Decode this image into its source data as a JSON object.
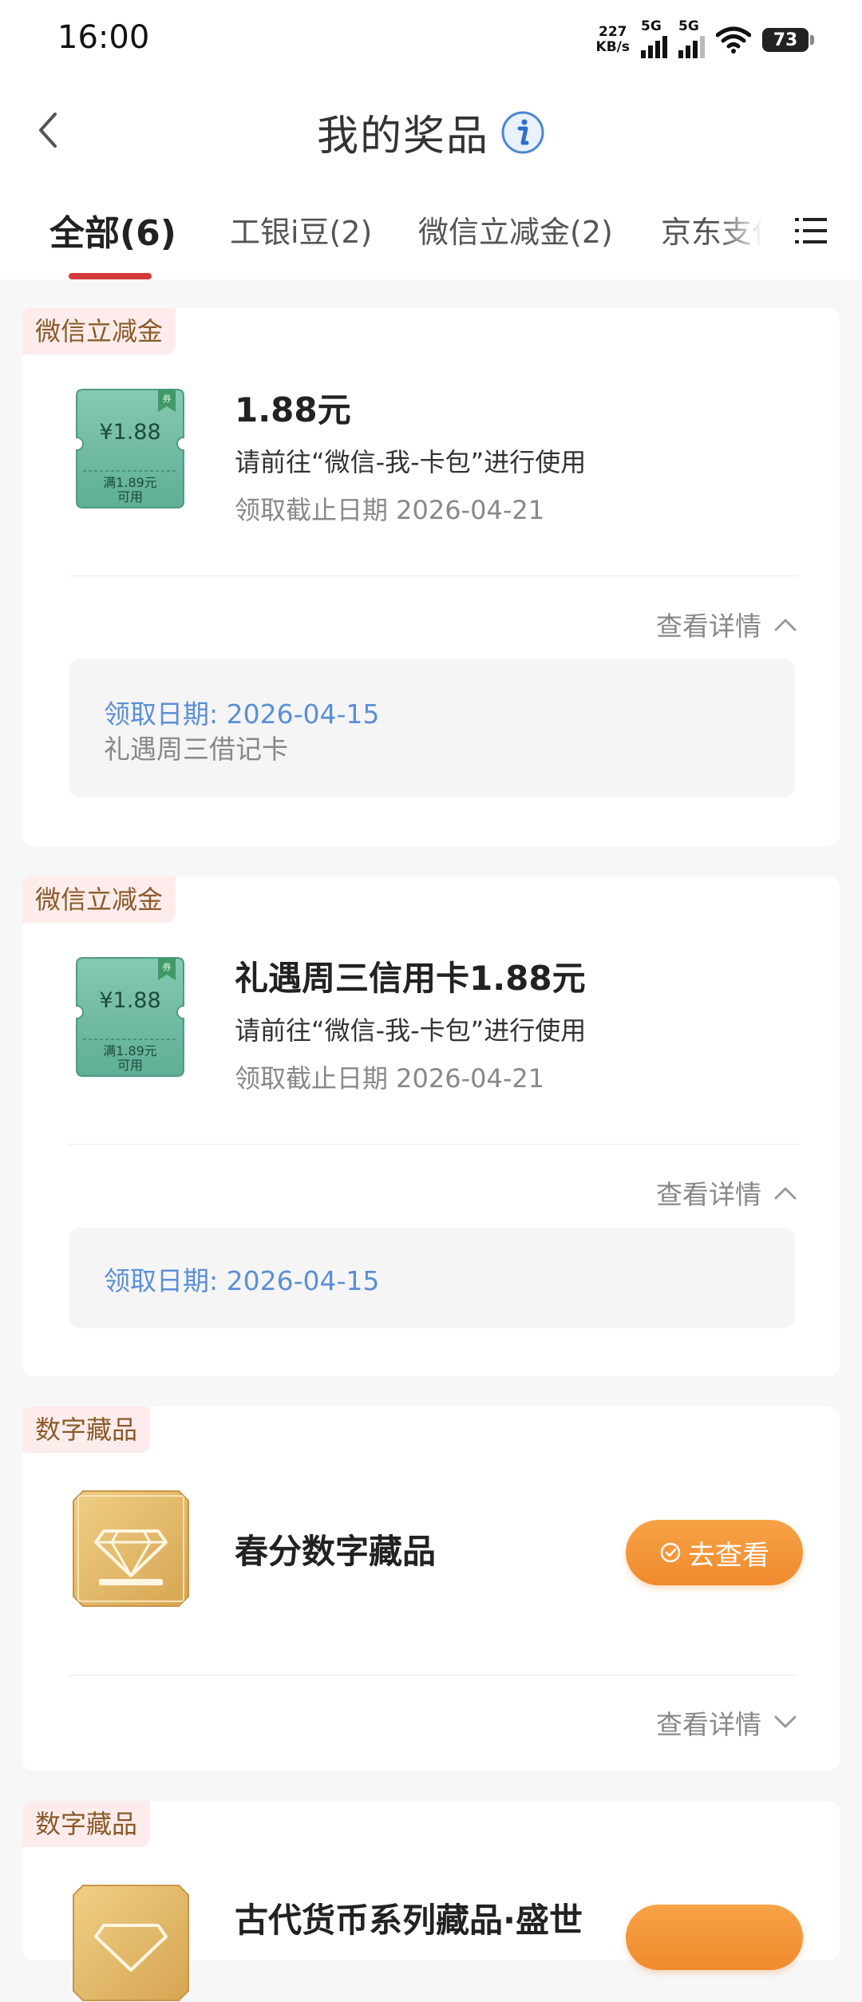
{
  "status_bar": {
    "time": "16:00",
    "net_speed_value": "227",
    "net_speed_unit": "KB/s",
    "sim1": "5G",
    "sim2": "5G",
    "battery": "73"
  },
  "header": {
    "title": "我的奖品"
  },
  "tabs": [
    {
      "label": "全部(6)",
      "active": true
    },
    {
      "label": "工银i豆(2)",
      "active": false
    },
    {
      "label": "微信立减金(2)",
      "active": false
    },
    {
      "label": "京东支付",
      "active": false
    }
  ],
  "prizes": [
    {
      "tag": "微信立减金",
      "coupon_amount": "¥1.88",
      "coupon_cond_line1": "满1.89元",
      "coupon_cond_line2": "可用",
      "coupon_corner": "券",
      "title": "1.88元",
      "desc": "请前往“微信-我-卡包”进行使用",
      "deadline": "领取截止日期 2026-04-21",
      "detail_toggle": "查看详情",
      "detail_date": "领取日期: 2026-04-15",
      "detail_card": "礼遇周三借记卡"
    },
    {
      "tag": "微信立减金",
      "coupon_amount": "¥1.88",
      "coupon_cond_line1": "满1.89元",
      "coupon_cond_line2": "可用",
      "coupon_corner": "券",
      "title": "礼遇周三信用卡1.88元",
      "desc": "请前往“微信-我-卡包”进行使用",
      "deadline": "领取截止日期 2026-04-21",
      "detail_toggle": "查看详情",
      "detail_date": "领取日期: 2026-04-15"
    },
    {
      "tag": "数字藏品",
      "title": "春分数字藏品",
      "action": "去查看",
      "detail_toggle": "查看详情"
    },
    {
      "tag": "数字藏品",
      "title": "古代货币系列藏品·盛世"
    }
  ],
  "colors": {
    "accent_red": "#d43a3a",
    "coupon_green": "#5fae96",
    "action_orange": "#f08a2d",
    "link_blue": "#5b8fd6",
    "gold": "#dcb062"
  }
}
